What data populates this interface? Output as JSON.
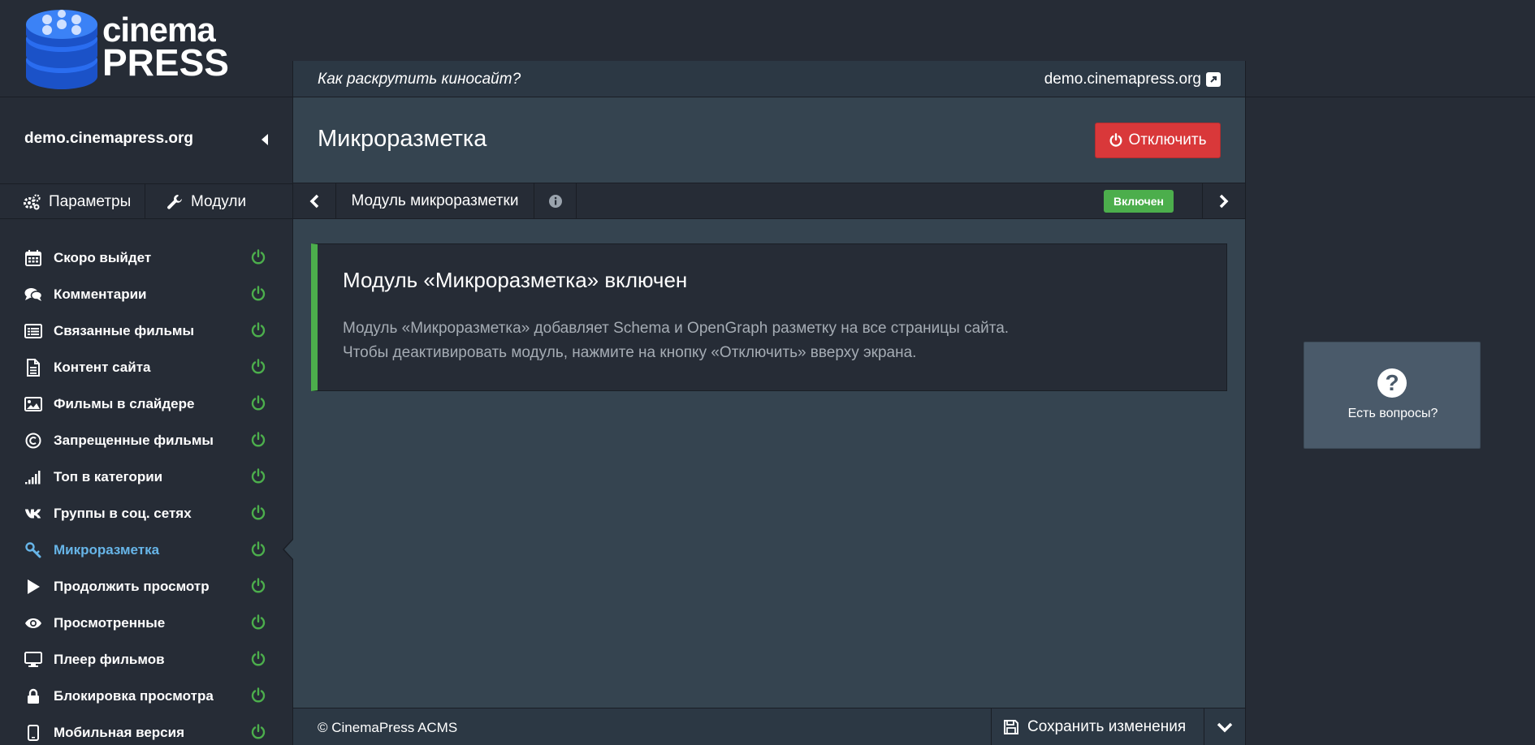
{
  "brand": {
    "line1": "cinema",
    "line2": "PRESS"
  },
  "sidebar": {
    "site_name": "demo.cinemapress.org",
    "tabs": [
      {
        "label": "Параметры",
        "icon": "gears-icon"
      },
      {
        "label": "Модули",
        "icon": "wrench-icon"
      }
    ],
    "items": [
      {
        "label": "Скоро выйдет",
        "icon": "calendar-icon",
        "active": false
      },
      {
        "label": "Комментарии",
        "icon": "comments-icon",
        "active": false
      },
      {
        "label": "Связанные фильмы",
        "icon": "list-alt-icon",
        "active": false
      },
      {
        "label": "Контент сайта",
        "icon": "file-icon",
        "active": false
      },
      {
        "label": "Фильмы в слайдере",
        "icon": "image-icon",
        "active": false
      },
      {
        "label": "Запрещенные фильмы",
        "icon": "copyright-icon",
        "active": false
      },
      {
        "label": "Топ в категории",
        "icon": "signal-icon",
        "active": false
      },
      {
        "label": "Группы в соц. сетях",
        "icon": "vk-icon",
        "active": false
      },
      {
        "label": "Микроразметка",
        "icon": "wrench-icon",
        "active": true
      },
      {
        "label": "Продолжить просмотр",
        "icon": "play-icon",
        "active": false
      },
      {
        "label": "Просмотренные",
        "icon": "eye-icon",
        "active": false
      },
      {
        "label": "Плеер фильмов",
        "icon": "monitor-icon",
        "active": false
      },
      {
        "label": "Блокировка просмотра",
        "icon": "lock-icon",
        "active": false
      },
      {
        "label": "Мобильная версия",
        "icon": "mobile-icon",
        "active": false
      }
    ]
  },
  "header": {
    "promo_link": "Как раскрутить киносайт?",
    "site_link": "demo.cinemapress.org"
  },
  "page": {
    "title": "Микроразметка",
    "disable_button": "Отключить"
  },
  "module_bar": {
    "label": "Модуль микроразметки",
    "status": "Включен"
  },
  "callout": {
    "title": "Модуль «Микроразметка» включен",
    "line1": "Модуль «Микроразметка» добавляет Schema и OpenGraph разметку на все страницы сайта.",
    "line2": "Чтобы деактивировать модуль, нажмите на кнопку «Отключить» вверху экрана."
  },
  "footer": {
    "copyright": "© CinemaPress ACMS",
    "save_button": "Сохранить изменения"
  },
  "help": {
    "label": "Есть вопросы?"
  },
  "colors": {
    "background": "#262c36",
    "panel": "#354450",
    "accent_green": "#4cae4c",
    "accent_red": "#d9383a",
    "active_link": "#67b5e8",
    "muted_text": "#a5acb4"
  }
}
